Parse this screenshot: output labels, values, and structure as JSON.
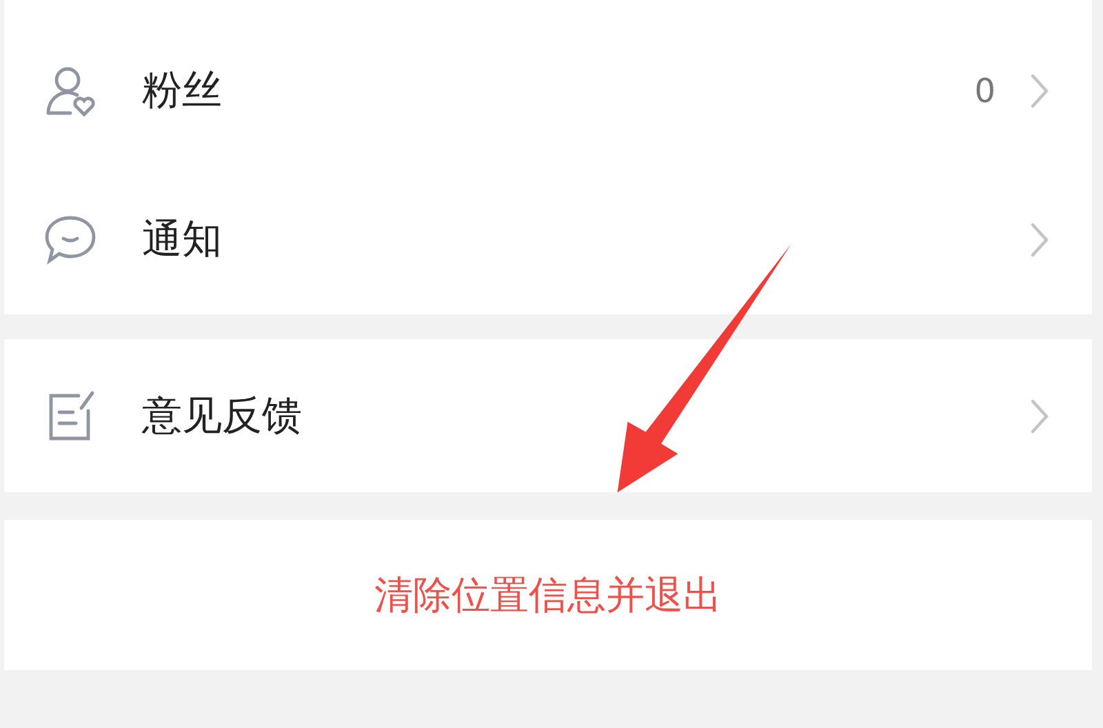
{
  "menu_groups": [
    {
      "items": [
        {
          "label": "粉丝",
          "count": "0"
        },
        {
          "label": "通知"
        }
      ]
    },
    {
      "items": [
        {
          "label": "意见反馈"
        }
      ]
    }
  ],
  "logout_button": {
    "label": "清除位置信息并退出"
  },
  "overlays": [
    {
      "kind": "arrow"
    }
  ]
}
